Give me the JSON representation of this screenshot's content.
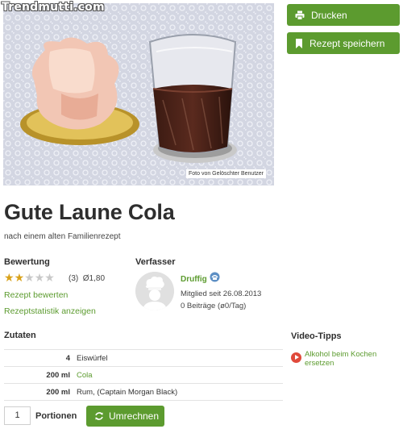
{
  "watermark": "Trendmutti.com",
  "photo": {
    "credit": "Foto von Gelöschter Benutzer"
  },
  "actions": {
    "print_label": "Drucken",
    "save_label": "Rezept speichern"
  },
  "recipe": {
    "title": "Gute Laune Cola",
    "subtitle": "nach einem alten Familienrezept"
  },
  "rating": {
    "label": "Bewertung",
    "stars_filled": 2,
    "stars_total": 5,
    "summary": "(3)  Ø1,80",
    "rate_link": "Rezept bewerten",
    "stats_link": "Rezeptstatistik anzeigen"
  },
  "author": {
    "label": "Verfasser",
    "name": "Druffig",
    "member_since": "Mitglied seit 26.08.2013",
    "contributions": "0 Beiträge (ø0/Tag)"
  },
  "ingredients": {
    "label": "Zutaten",
    "rows": [
      {
        "amount": "4",
        "name": "Eiswürfel",
        "link": false
      },
      {
        "amount": "200 ml",
        "name": "Cola",
        "link": true
      },
      {
        "amount": "200 ml",
        "name": "Rum, (Captain Morgan Black)",
        "link": false
      }
    ]
  },
  "video": {
    "label": "Video-Tipps",
    "items": [
      {
        "title": "Alkohol beim Kochen ersetzen"
      }
    ]
  },
  "portions": {
    "value": "1",
    "label": "Portionen",
    "convert_label": "Umrechnen"
  },
  "colors": {
    "accent": "#5c9b2f",
    "star": "#d9a21b",
    "play": "#e04a3b"
  }
}
